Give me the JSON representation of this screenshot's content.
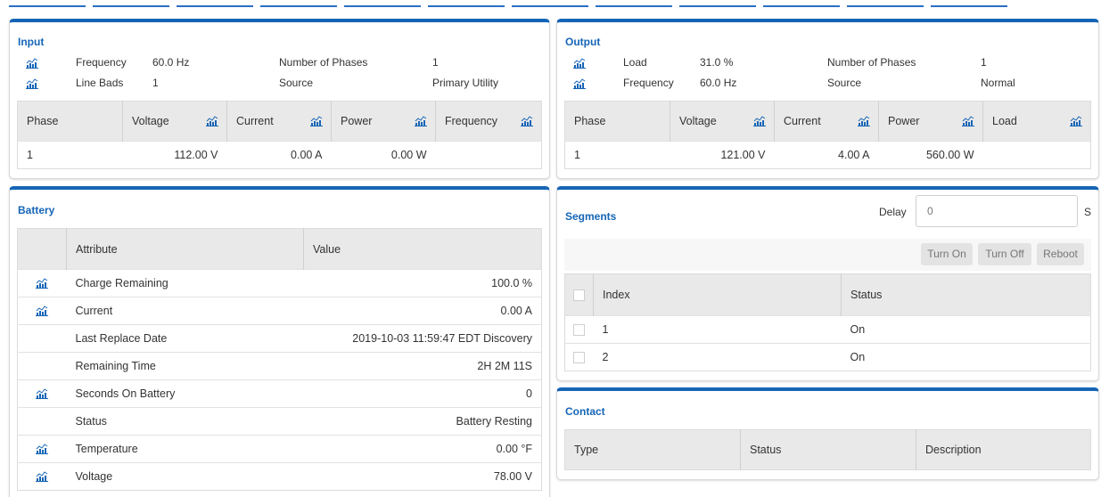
{
  "colors": {
    "accent": "#1565b6",
    "header_bg": "#e9e9e9"
  },
  "top_tab_count": 12,
  "input": {
    "title": "Input",
    "frequency_label": "Frequency",
    "frequency_value": "60.0 Hz",
    "phases_label": "Number of Phases",
    "phases_value": "1",
    "linebads_label": "Line Bads",
    "linebads_value": "1",
    "source_label": "Source",
    "source_value": "Primary Utility",
    "columns": [
      "Phase",
      "Voltage",
      "Current",
      "Power",
      "Frequency"
    ],
    "rows": [
      {
        "phase": "1",
        "voltage": "112.00 V",
        "current": "0.00 A",
        "power": "0.00 W",
        "frequency": ""
      }
    ]
  },
  "output": {
    "title": "Output",
    "load_label": "Load",
    "load_value": "31.0 %",
    "phases_label": "Number of Phases",
    "phases_value": "1",
    "frequency_label": "Frequency",
    "frequency_value": "60.0 Hz",
    "source_label": "Source",
    "source_value": "Normal",
    "columns": [
      "Phase",
      "Voltage",
      "Current",
      "Power",
      "Load"
    ],
    "rows": [
      {
        "phase": "1",
        "voltage": "121.00 V",
        "current": "4.00 A",
        "power": "560.00 W",
        "load": ""
      }
    ]
  },
  "battery": {
    "title": "Battery",
    "columns": [
      "",
      "Attribute",
      "Value"
    ],
    "rows": [
      {
        "icon": true,
        "attribute": "Charge Remaining",
        "value": "100.0 %"
      },
      {
        "icon": true,
        "attribute": "Current",
        "value": "0.00 A"
      },
      {
        "icon": false,
        "attribute": "Last Replace Date",
        "value": "2019-10-03 11:59:47 EDT Discovery"
      },
      {
        "icon": false,
        "attribute": "Remaining Time",
        "value": "2H 2M 11S"
      },
      {
        "icon": true,
        "attribute": "Seconds On Battery",
        "value": "0"
      },
      {
        "icon": false,
        "attribute": "Status",
        "value": "Battery Resting"
      },
      {
        "icon": true,
        "attribute": "Temperature",
        "value": "0.00 °F"
      },
      {
        "icon": true,
        "attribute": "Voltage",
        "value": "78.00 V"
      }
    ]
  },
  "segments": {
    "title": "Segments",
    "delay_label": "Delay",
    "delay_value": "0",
    "delay_unit": "S",
    "buttons": {
      "turn_on": "Turn On",
      "turn_off": "Turn Off",
      "reboot": "Reboot"
    },
    "columns": [
      "Index",
      "Status"
    ],
    "rows": [
      {
        "index": "1",
        "status": "On"
      },
      {
        "index": "2",
        "status": "On"
      }
    ]
  },
  "contact": {
    "title": "Contact",
    "columns": [
      "Type",
      "Status",
      "Description"
    ]
  }
}
